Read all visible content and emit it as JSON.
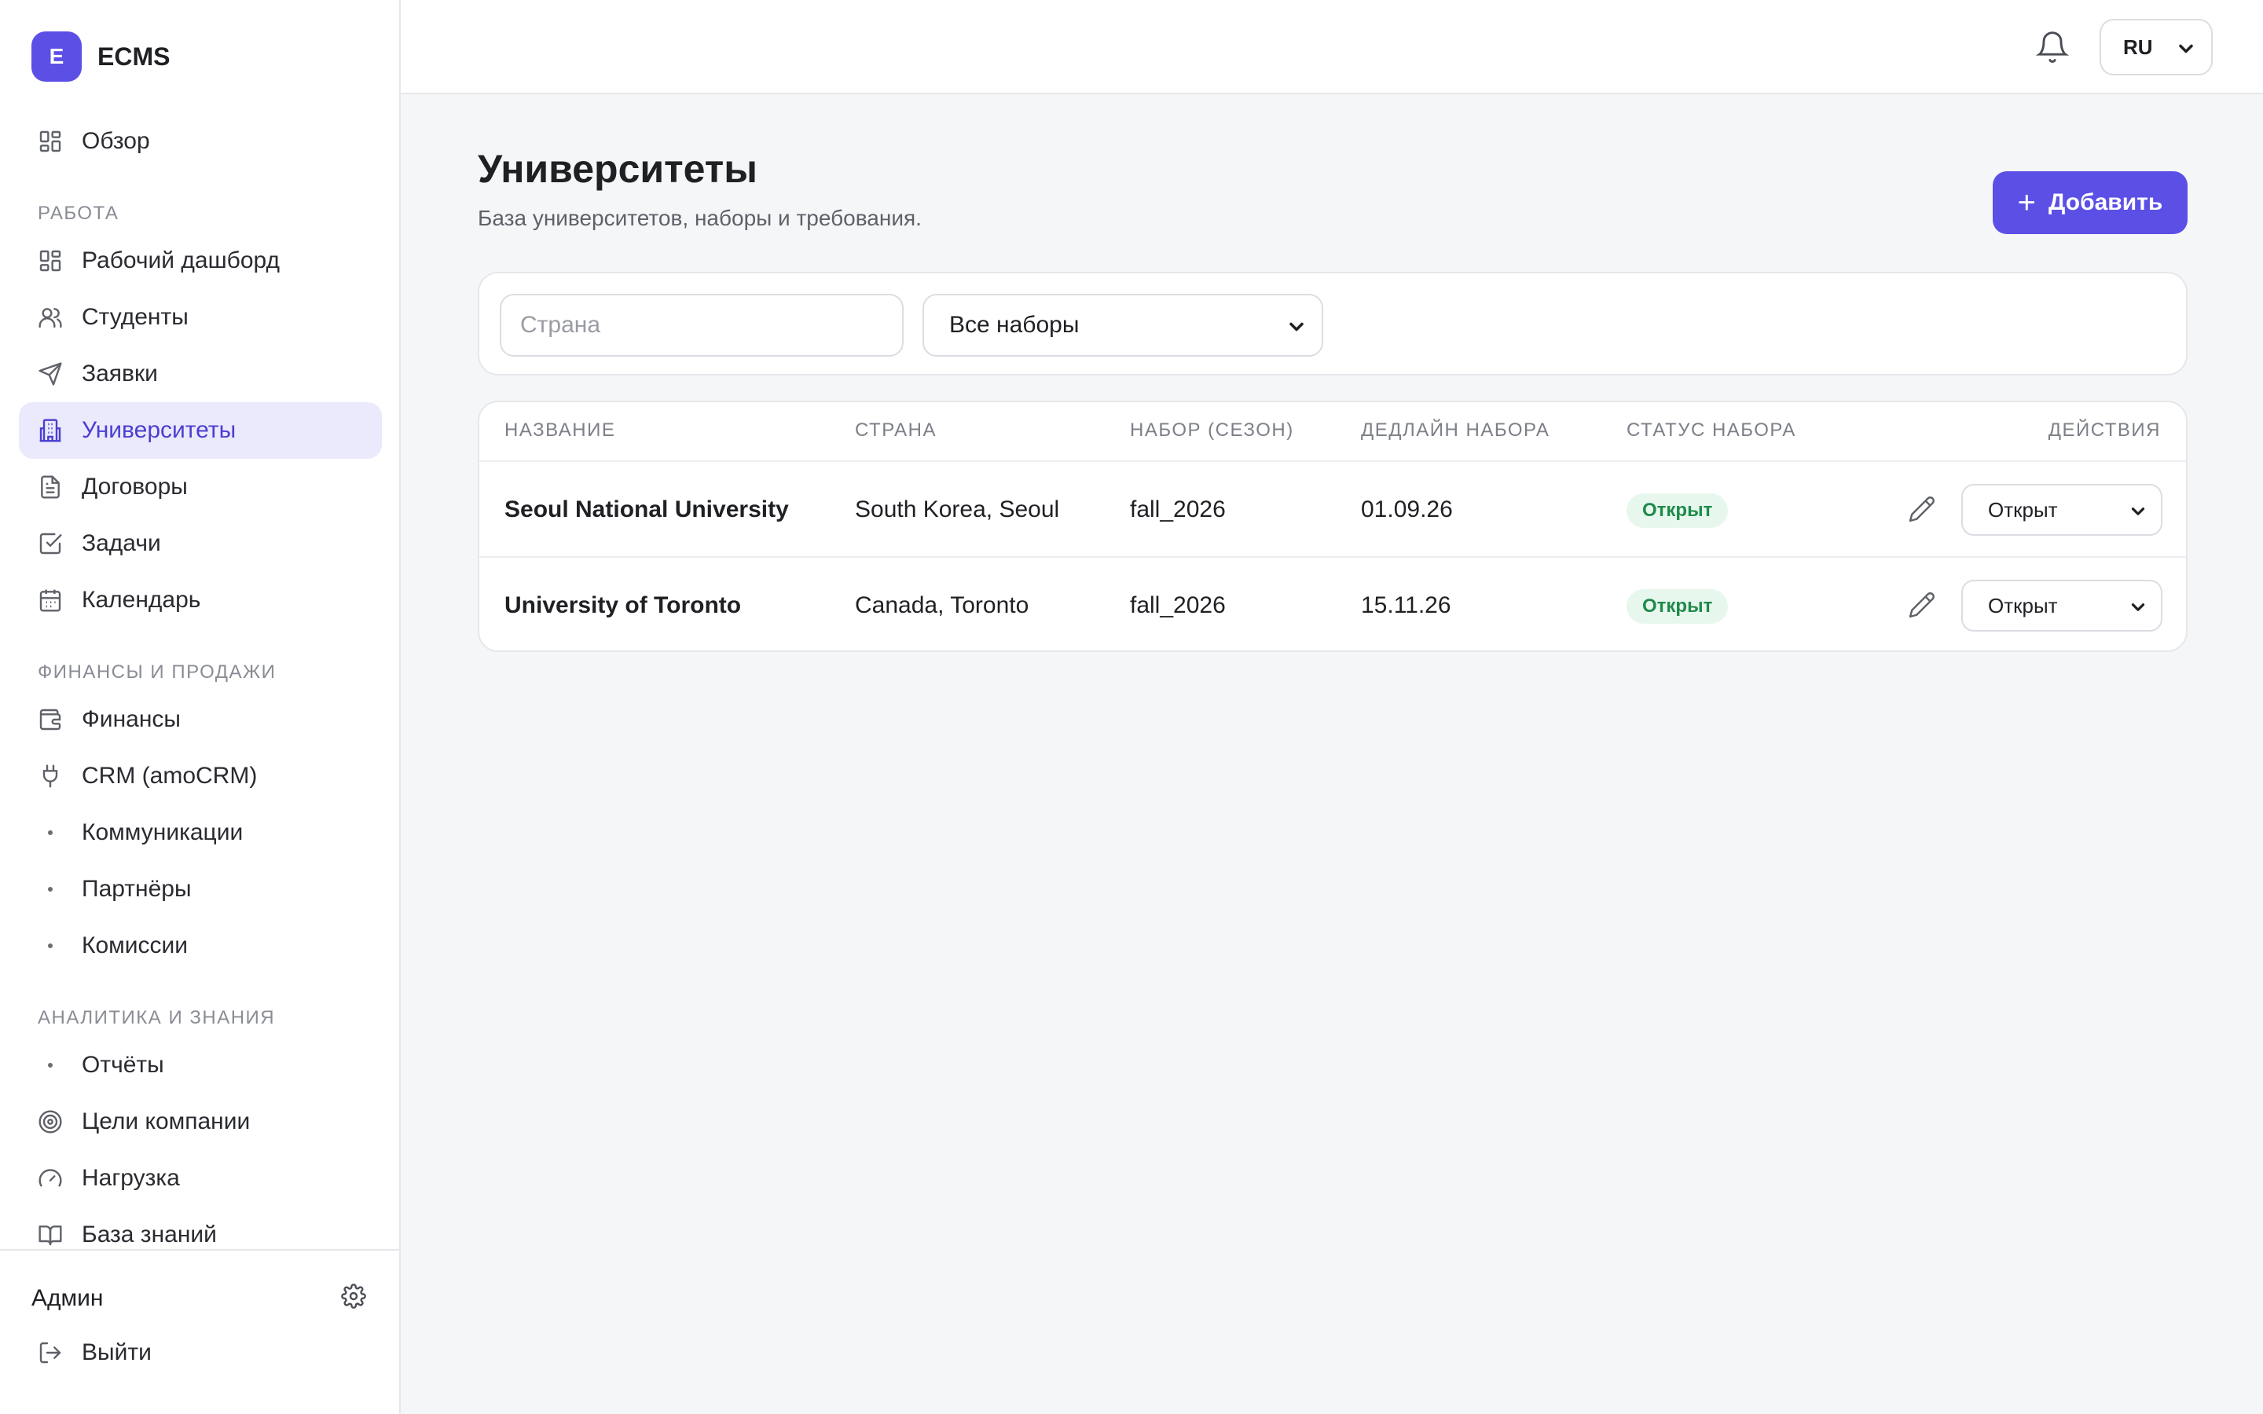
{
  "brand": {
    "logo_letter": "E",
    "name": "ECMS"
  },
  "colors": {
    "accent": "#5b4fe6",
    "active_bg": "#ebe9fc",
    "status_green": "#1f8a4a",
    "status_green_bg": "#e7f7ee"
  },
  "sidebar": {
    "overview": {
      "label": "Обзор",
      "icon": "grid-icon"
    },
    "sections": {
      "work": "РАБОТА",
      "finance": "ФИНАНСЫ И ПРОДАЖИ",
      "analytics": "АНАЛИТИКА И ЗНАНИЯ"
    },
    "items": {
      "dashboard": {
        "label": "Рабочий дашборд",
        "icon": "grid-icon"
      },
      "students": {
        "label": "Студенты",
        "icon": "users-icon"
      },
      "applications": {
        "label": "Заявки",
        "icon": "send-icon"
      },
      "universities": {
        "label": "Университеты",
        "icon": "building-icon"
      },
      "contracts": {
        "label": "Договоры",
        "icon": "document-icon"
      },
      "tasks": {
        "label": "Задачи",
        "icon": "checkbox-icon"
      },
      "calendar": {
        "label": "Календарь",
        "icon": "calendar-icon"
      },
      "finances": {
        "label": "Финансы",
        "icon": "wallet-icon"
      },
      "crm": {
        "label": "CRM (amoCRM)",
        "icon": "plug-icon"
      },
      "communications": {
        "label": "Коммуникации",
        "icon": "dot-icon"
      },
      "partners": {
        "label": "Партнёры",
        "icon": "dot-icon"
      },
      "commissions": {
        "label": "Комиссии",
        "icon": "dot-icon"
      },
      "reports": {
        "label": "Отчёты",
        "icon": "dot-icon"
      },
      "goals": {
        "label": "Цели компании",
        "icon": "target-icon"
      },
      "workload": {
        "label": "Нагрузка",
        "icon": "gauge-icon"
      },
      "knowledge": {
        "label": "База знаний",
        "icon": "book-icon"
      }
    },
    "footer": {
      "user_name": "Админ",
      "logout_label": "Выйти"
    }
  },
  "topbar": {
    "language": "RU"
  },
  "page": {
    "title": "Университеты",
    "subtitle": "База университетов, наборы и требования.",
    "add_label": "Добавить"
  },
  "filters": {
    "country_placeholder": "Страна",
    "country_value": "",
    "season_selected": "Все наборы"
  },
  "table": {
    "headers": {
      "name": "НАЗВАНИЕ",
      "country": "СТРАНА",
      "season": "НАБОР (СЕЗОН)",
      "deadline": "ДЕДЛАЙН НАБОРА",
      "status": "СТАТУС НАБОРА",
      "actions": "ДЕЙСТВИЯ"
    },
    "rows": [
      {
        "name": "Seoul National University",
        "country": "South Korea, Seoul",
        "season": "fall_2026",
        "deadline": "01.09.26",
        "status": "Открыт",
        "status_select": "Открыт"
      },
      {
        "name": "University of Toronto",
        "country": "Canada, Toronto",
        "season": "fall_2026",
        "deadline": "15.11.26",
        "status": "Открыт",
        "status_select": "Открыт"
      }
    ]
  }
}
